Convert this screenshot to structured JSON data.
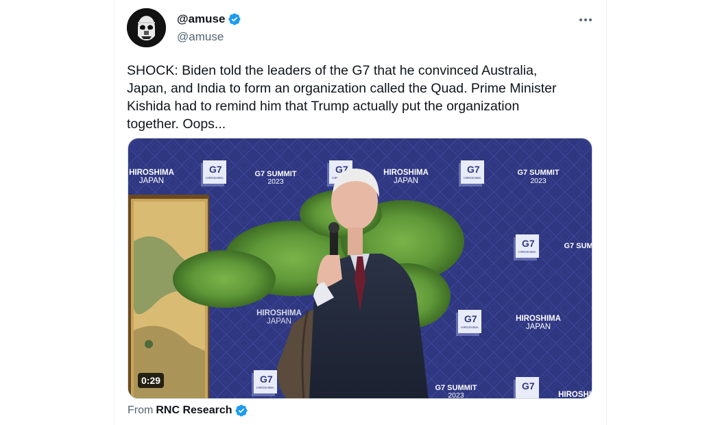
{
  "author": {
    "display_name": "@amuse",
    "handle": "@amuse",
    "verified": true,
    "avatar_icon": "stormtrooper-avatar-icon"
  },
  "tweet": {
    "text": "SHOCK: Biden told the leaders of the G7 that he convinced Australia,\nJapan, and India to form an organization called the Quad. Prime Minister\nKishida had to remind him that Trump actually put the organization\ntogether. Oops..."
  },
  "media": {
    "duration": "0:29",
    "backdrop": {
      "hiroshima": "HIROSHIMA",
      "japan": "JAPAN",
      "g7_summit": "G7 SUMMIT",
      "year": "2023",
      "logo_main": "G7",
      "logo_sub": "HIROSHIMA",
      "logo_small": "SUMMIT"
    }
  },
  "attribution": {
    "from_label": "From",
    "source": "RNC Research",
    "verified": true
  },
  "colors": {
    "verified_blue": "#1d9bf0",
    "backdrop_navy": "#2e3679",
    "text_primary": "#0f1419",
    "text_secondary": "#536471"
  }
}
